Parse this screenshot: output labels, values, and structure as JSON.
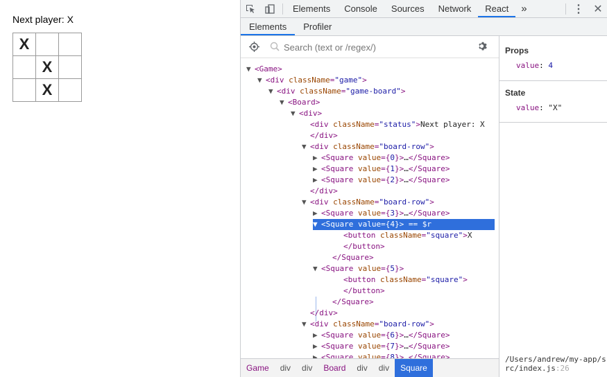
{
  "game": {
    "status": "Next player: X",
    "squares": [
      [
        "X",
        "",
        ""
      ],
      [
        "",
        "X",
        ""
      ],
      [
        "",
        "X",
        ""
      ]
    ]
  },
  "devtools": {
    "tabs": [
      "Elements",
      "Console",
      "Sources",
      "Network",
      "React"
    ],
    "active_tab": "React",
    "more": "»",
    "subtabs": [
      "Elements",
      "Profiler"
    ],
    "search_placeholder": "Search (text or /regex/)",
    "tree": [
      {
        "indent": 0,
        "arrow": "▼",
        "html": "<span class='tag'>&lt;Game&gt;</span>"
      },
      {
        "indent": 1,
        "arrow": "▼",
        "html": "<span class='tag'>&lt;div </span><span class='an'>className</span><span class='tag'>=</span><span class='av'>\"game\"</span><span class='tag'>&gt;</span>"
      },
      {
        "indent": 2,
        "arrow": "▼",
        "html": "<span class='tag'>&lt;div </span><span class='an'>className</span><span class='tag'>=</span><span class='av'>\"game-board\"</span><span class='tag'>&gt;</span>"
      },
      {
        "indent": 3,
        "arrow": "▼",
        "html": "<span class='tag'>&lt;Board&gt;</span>"
      },
      {
        "indent": 4,
        "arrow": "▼",
        "html": "<span class='tag'>&lt;div&gt;</span>"
      },
      {
        "indent": 5,
        "arrow": "",
        "html": "<span class='tag'>&lt;div </span><span class='an'>className</span><span class='tag'>=</span><span class='av'>\"status\"</span><span class='tag'>&gt;</span><span class='txt'>Next player: X</span>"
      },
      {
        "indent": 5,
        "arrow": "",
        "html": "<span class='tag'>&lt;/div&gt;</span>"
      },
      {
        "indent": 5,
        "arrow": "▼",
        "html": "<span class='tag'>&lt;div </span><span class='an'>className</span><span class='tag'>=</span><span class='av'>\"board-row\"</span><span class='tag'>&gt;</span>"
      },
      {
        "indent": 6,
        "arrow": "▶",
        "html": "<span class='tag'>&lt;Square </span><span class='an'>value</span><span class='tag'>={</span><span class='av'>0</span><span class='tag'>}&gt;</span><span class='txt'>…</span><span class='tag'>&lt;/Square&gt;</span>"
      },
      {
        "indent": 6,
        "arrow": "▶",
        "html": "<span class='tag'>&lt;Square </span><span class='an'>value</span><span class='tag'>={</span><span class='av'>1</span><span class='tag'>}&gt;</span><span class='txt'>…</span><span class='tag'>&lt;/Square&gt;</span>"
      },
      {
        "indent": 6,
        "arrow": "▶",
        "html": "<span class='tag'>&lt;Square </span><span class='an'>value</span><span class='tag'>={</span><span class='av'>2</span><span class='tag'>}&gt;</span><span class='txt'>…</span><span class='tag'>&lt;/Square&gt;</span>"
      },
      {
        "indent": 5,
        "arrow": "",
        "html": "<span class='tag'>&lt;/div&gt;</span>"
      },
      {
        "indent": 5,
        "arrow": "▼",
        "html": "<span class='tag'>&lt;div </span><span class='an'>className</span><span class='tag'>=</span><span class='av'>\"board-row\"</span><span class='tag'>&gt;</span>"
      },
      {
        "indent": 6,
        "arrow": "▶",
        "html": "<span class='tag'>&lt;Square </span><span class='an'>value</span><span class='tag'>={</span><span class='av'>3</span><span class='tag'>}&gt;</span><span class='txt'>…</span><span class='tag'>&lt;/Square&gt;</span>"
      },
      {
        "indent": 6,
        "arrow": "▼",
        "selected": true,
        "html": "<span class='tag'>&lt;Square </span><span class='an'>value</span><span class='tag'>={</span><span class='av'>4</span><span class='tag'>}&gt;</span><span class='txt'> == $r</span>"
      },
      {
        "indent": 8,
        "arrow": "",
        "html": "<span class='tag'>&lt;button </span><span class='an'>className</span><span class='tag'>=</span><span class='av'>\"square\"</span><span class='tag'>&gt;</span><span class='txt'>X</span>"
      },
      {
        "indent": 8,
        "arrow": "",
        "html": "<span class='tag'>&lt;/button&gt;</span>"
      },
      {
        "indent": 7,
        "arrow": "",
        "html": "<span class='tag'>&lt;/Square&gt;</span>"
      },
      {
        "indent": 6,
        "arrow": "▼",
        "html": "<span class='tag'>&lt;Square </span><span class='an'>value</span><span class='tag'>={</span><span class='av'>5</span><span class='tag'>}&gt;</span>"
      },
      {
        "indent": 8,
        "arrow": "",
        "html": "<span class='tag'>&lt;button </span><span class='an'>className</span><span class='tag'>=</span><span class='av'>\"square\"</span><span class='tag'>&gt;</span>"
      },
      {
        "indent": 8,
        "arrow": "",
        "html": "<span class='tag'>&lt;/button&gt;</span>"
      },
      {
        "indent": 7,
        "arrow": "",
        "html": "<span class='tag'>&lt;/Square&gt;</span>"
      },
      {
        "indent": 5,
        "arrow": "",
        "html": "<span class='tag'>&lt;/div&gt;</span>"
      },
      {
        "indent": 5,
        "arrow": "▼",
        "html": "<span class='tag'>&lt;div </span><span class='an'>className</span><span class='tag'>=</span><span class='av'>\"board-row\"</span><span class='tag'>&gt;</span>"
      },
      {
        "indent": 6,
        "arrow": "▶",
        "html": "<span class='tag'>&lt;Square </span><span class='an'>value</span><span class='tag'>={</span><span class='av'>6</span><span class='tag'>}&gt;</span><span class='txt'>…</span><span class='tag'>&lt;/Square&gt;</span>"
      },
      {
        "indent": 6,
        "arrow": "▶",
        "html": "<span class='tag'>&lt;Square </span><span class='an'>value</span><span class='tag'>={</span><span class='av'>7</span><span class='tag'>}&gt;</span><span class='txt'>…</span><span class='tag'>&lt;/Square&gt;</span>"
      },
      {
        "indent": 6,
        "arrow": "▶",
        "html": "<span class='tag'>&lt;Square </span><span class='an'>value</span><span class='tag'>={</span><span class='av'>8</span><span class='tag'>}&gt;</span><span class='txt'>…</span><span class='tag'>&lt;/Square&gt;</span>"
      }
    ],
    "breadcrumbs": [
      {
        "label": "Game",
        "kind": "comp"
      },
      {
        "label": "div",
        "kind": "dom"
      },
      {
        "label": "div",
        "kind": "dom"
      },
      {
        "label": "Board",
        "kind": "comp"
      },
      {
        "label": "div",
        "kind": "dom"
      },
      {
        "label": "div",
        "kind": "dom"
      },
      {
        "label": "Square",
        "kind": "sel"
      }
    ],
    "props_header": "Props",
    "props": [
      {
        "key": "value",
        "sep": ": ",
        "val": "4"
      }
    ],
    "state_header": "State",
    "state": [
      {
        "key": "value",
        "sep": ": ",
        "val": "\"X\""
      }
    ],
    "source_path": "/Users/andrew/my-app/src/index.js",
    "source_line": ":26",
    "colors": {
      "accent": "#1a73e8",
      "selection": "#2f6fdc",
      "tag": "#881280",
      "attr": "#994500",
      "value": "#1a1aa6"
    }
  }
}
